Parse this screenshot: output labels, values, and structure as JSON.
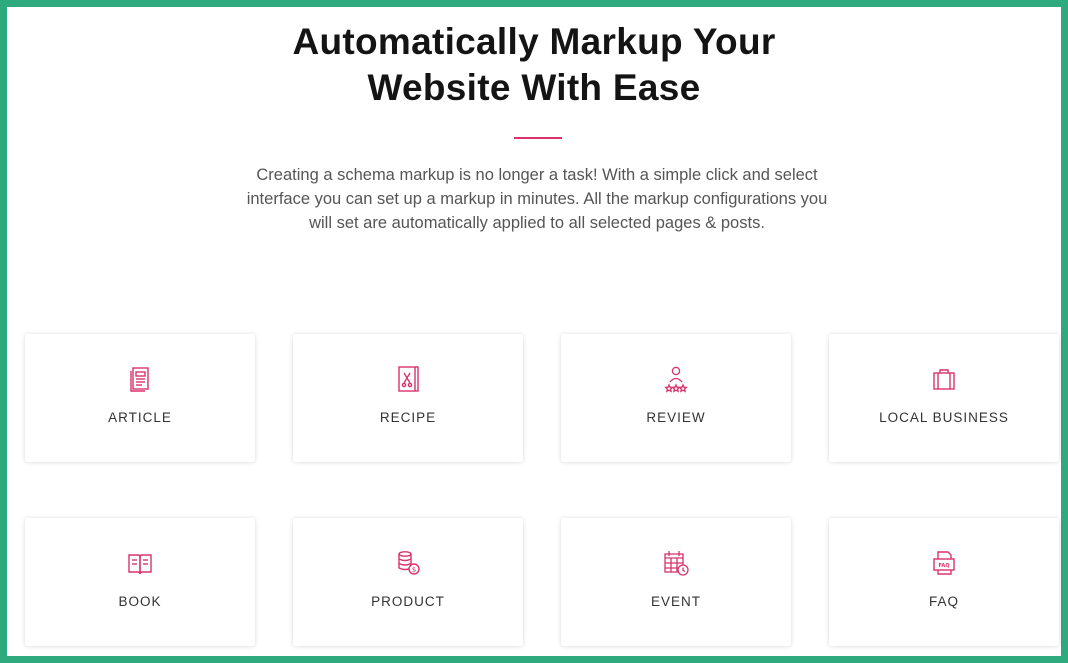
{
  "heading": {
    "line1": "Automatically Markup Your",
    "line2": "Website With Ease"
  },
  "intro": {
    "line1": "Creating a schema markup is no longer a task! With a simple click and select",
    "line2": "interface you can set up a markup in minutes. All the markup configurations you",
    "line3": "will set are automatically applied to all selected pages & posts."
  },
  "colors": {
    "frame": "#2eaa7e",
    "accent": "#d8336b",
    "heading": "#141414",
    "body_text": "#555555"
  },
  "cards": [
    {
      "label": "ARTICLE",
      "icon": "article-icon"
    },
    {
      "label": "RECIPE",
      "icon": "recipe-icon"
    },
    {
      "label": "REVIEW",
      "icon": "review-icon"
    },
    {
      "label": "LOCAL BUSINESS",
      "icon": "local-business-icon"
    },
    {
      "label": "BOOK",
      "icon": "book-icon"
    },
    {
      "label": "PRODUCT",
      "icon": "product-icon"
    },
    {
      "label": "EVENT",
      "icon": "event-icon"
    },
    {
      "label": "FAQ",
      "icon": "faq-icon"
    }
  ]
}
